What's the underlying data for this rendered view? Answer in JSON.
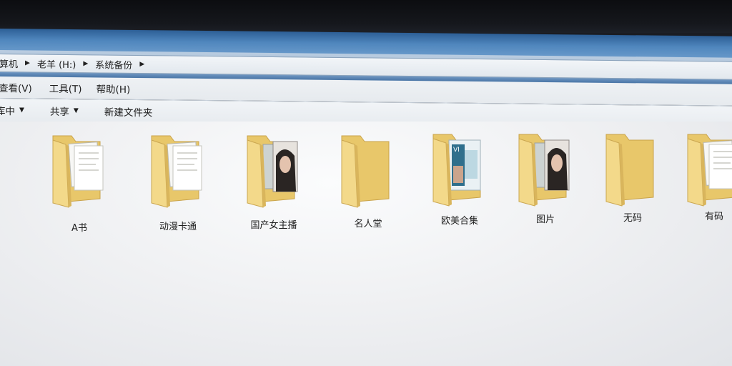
{
  "window": {
    "breadcrumb": [
      {
        "label": "算机"
      },
      {
        "label": "老羊 (H:)"
      },
      {
        "label": "系统备份"
      }
    ]
  },
  "menu": {
    "items": [
      {
        "label": "查看(V)"
      },
      {
        "label": "工具(T)"
      },
      {
        "label": "帮助(H)"
      }
    ]
  },
  "toolbar": {
    "include_label": "库中",
    "share_label": "共享",
    "new_folder_label": "新建文件夹"
  },
  "folders": [
    {
      "label": "A书",
      "preview": "documents"
    },
    {
      "label": "动漫卡通",
      "preview": "documents"
    },
    {
      "label": "国产女主播",
      "preview": "photos"
    },
    {
      "label": "名人堂",
      "preview": "empty"
    },
    {
      "label": "欧美合集",
      "preview": "video"
    },
    {
      "label": "图片",
      "preview": "photos"
    },
    {
      "label": "无码",
      "preview": "empty"
    },
    {
      "label": "有码",
      "preview": "documents"
    }
  ],
  "colors": {
    "folder_back": "#e8c76a",
    "folder_front": "#f3d98a",
    "title_blue": "#4f86bd"
  }
}
